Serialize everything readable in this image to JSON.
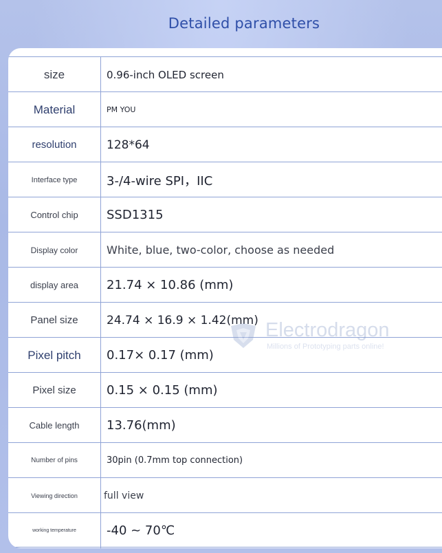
{
  "header": {
    "title": "Detailed parameters"
  },
  "rows": [
    {
      "label": "size",
      "value": "0.96-inch OLED screen"
    },
    {
      "label": "Material",
      "value": "PM YOU"
    },
    {
      "label": "resolution",
      "value": "128*64"
    },
    {
      "label": "Interface type",
      "value": "3-/4-wire SPI，IIC"
    },
    {
      "label": "Control chip",
      "value": "SSD1315"
    },
    {
      "label": "Display color",
      "value": "White, blue, two-color, choose as needed"
    },
    {
      "label": "display area",
      "value": "21.74 × 10.86 (mm)"
    },
    {
      "label": "Panel size",
      "value": "24.74 × 16.9 × 1.42(mm)"
    },
    {
      "label": "Pixel pitch",
      "value": "0.17× 0.17 (mm)"
    },
    {
      "label": "Pixel size",
      "value": "0.15 × 0.15 (mm)"
    },
    {
      "label": "Cable length",
      "value": "13.76(mm)"
    },
    {
      "label": "Number of pins",
      "value": "30pin (0.7mm top connection)"
    },
    {
      "label": "Viewing direction",
      "value": "full view"
    },
    {
      "label": "working temperature",
      "value": "-40 ~ 70℃"
    }
  ],
  "watermark": {
    "name": "Electrodragon",
    "tagline": "Millions of Prototyping parts online!"
  },
  "colors": {
    "background": "#aebde8",
    "title": "#2f4fa8",
    "grid_line": "#8fa3d6",
    "card": "#ffffff"
  }
}
